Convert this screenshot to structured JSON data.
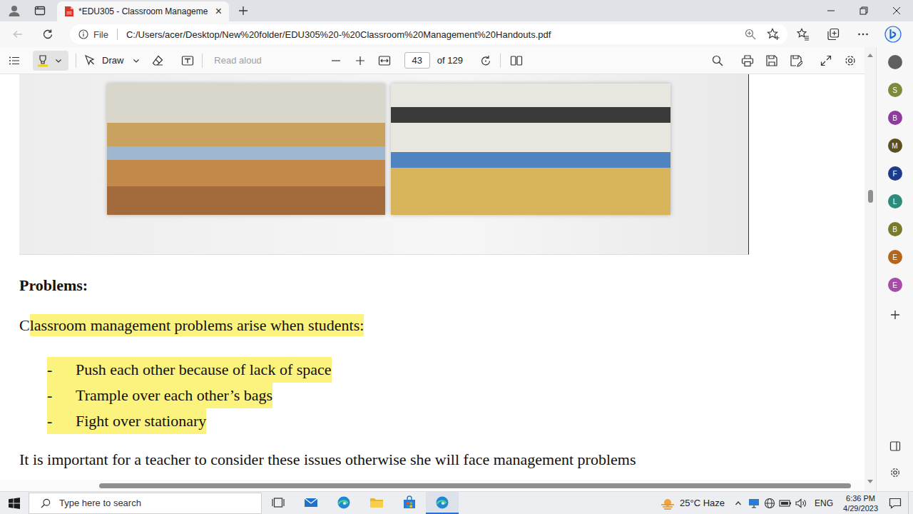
{
  "browser": {
    "tabs": [
      {
        "label": "*EDU305 - Classroom Manageme",
        "selected": true,
        "close": "×"
      }
    ]
  },
  "address_bar": {
    "back_disabled": true,
    "scheme": "File",
    "url": "C:/Users/acer/Desktop/New%20folder/EDU305%20-%20Classroom%20Management%20Handouts.pdf"
  },
  "pdf_toolbar": {
    "highlight_selected": true,
    "draw_label": "Draw",
    "read_aloud": {
      "label": "Read aloud",
      "disabled": true
    },
    "page": "43",
    "page_total": "of 129"
  },
  "document": {
    "heading": "Problems:",
    "intro": [
      {
        "text": "C",
        "highlighted": false
      },
      {
        "text": "lassroom management problems arise when students:",
        "highlighted": true
      }
    ],
    "bullets": [
      {
        "marker": "-",
        "text": "Push each other because of lack of space",
        "highlighted": true
      },
      {
        "marker": "-",
        "text": "Trample over each other’s bags",
        "highlighted": true
      },
      {
        "marker": "-",
        "text": "Fight over stationary",
        "highlighted": true
      }
    ],
    "closing": "It is important for a teacher to consider these issues otherwise she will face management problems"
  },
  "scroll": {
    "vertical_level": 0.32,
    "horizontal_level": 0.88
  },
  "sidebar": {
    "items": [
      {
        "letter": "",
        "color": "#5f5f5f"
      },
      {
        "letter": "S",
        "color": "#7d8a3a"
      },
      {
        "letter": "B",
        "color": "#8e3a9e"
      },
      {
        "letter": "M",
        "color": "#5a5020"
      },
      {
        "letter": "F",
        "color": "#1f3a8a"
      },
      {
        "letter": "L",
        "color": "#2e8b7a"
      },
      {
        "letter": "B",
        "color": "#7a7a2a"
      },
      {
        "letter": "E",
        "color": "#b5651d"
      },
      {
        "letter": "E",
        "color": "#a64ca6"
      }
    ]
  },
  "taskbar": {
    "search_placeholder": "Type here to search",
    "apps": [
      {
        "kind": "task-view",
        "active": false
      },
      {
        "kind": "mail",
        "active": false
      },
      {
        "kind": "edge",
        "active": false
      },
      {
        "kind": "file-explorer",
        "active": false
      },
      {
        "kind": "store",
        "active": false
      },
      {
        "kind": "edge",
        "active": true
      }
    ],
    "weather": "25°C Haze",
    "language": "ENG",
    "time": "6:36 PM",
    "date": "4/29/2023"
  }
}
